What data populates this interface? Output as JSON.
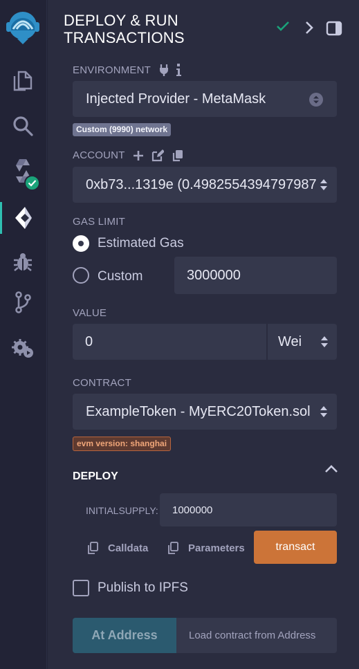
{
  "header": {
    "title_line1": "DEPLOY & RUN",
    "title_line2": "TRANSACTIONS"
  },
  "environment": {
    "label": "ENVIRONMENT",
    "value": "Injected Provider - MetaMask",
    "network_badge": "Custom (9990) network"
  },
  "account": {
    "label": "ACCOUNT",
    "value": "0xb73...1319e (0.4982554394797987"
  },
  "gas_limit": {
    "label": "GAS LIMIT",
    "estimated_label": "Estimated Gas",
    "custom_label": "Custom",
    "custom_value": "3000000",
    "selected": "estimated"
  },
  "value": {
    "label": "VALUE",
    "amount": "0",
    "unit": "Wei"
  },
  "contract": {
    "label": "CONTRACT",
    "value": "ExampleToken - MyERC20Token.sol",
    "evm_badge": "evm version: shanghai"
  },
  "deploy": {
    "title": "DEPLOY",
    "param_label": "INITIALSUPPLY:",
    "param_value": "1000000",
    "calldata_label": "Calldata",
    "parameters_label": "Parameters",
    "transact_label": "transact"
  },
  "publish": {
    "label": "Publish to IPFS",
    "checked": false
  },
  "at_address": {
    "button_label": "At Address",
    "placeholder": "Load contract from Address"
  },
  "colors": {
    "accent_teal": "#2fbfb1",
    "transact_orange": "#cc7438",
    "panel_bg": "#2a2c3f",
    "success_green": "#1aa37a"
  },
  "icons": {
    "rail": [
      "remix-logo-icon",
      "file-explorer-icon",
      "search-icon",
      "solidity-compiler-icon",
      "deploy-run-icon",
      "debugger-icon",
      "git-icon",
      "plugin-manager-icon"
    ],
    "header": [
      "check-icon",
      "chevron-right-icon",
      "dock-panel-icon"
    ]
  }
}
